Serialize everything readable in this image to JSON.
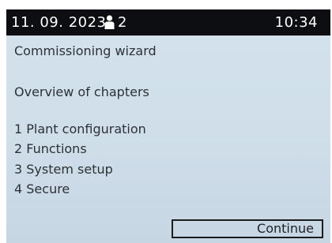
{
  "status_bar": {
    "date": "11. 09. 2023",
    "user_icon": "user-icon",
    "user_count": "2",
    "time": "10:34"
  },
  "title": "Commissioning wizard",
  "subtitle": "Overview of chapters",
  "chapters": [
    "1 Plant configuration",
    "2 Functions",
    "3 System setup",
    "4 Secure"
  ],
  "continue_label": "Continue"
}
